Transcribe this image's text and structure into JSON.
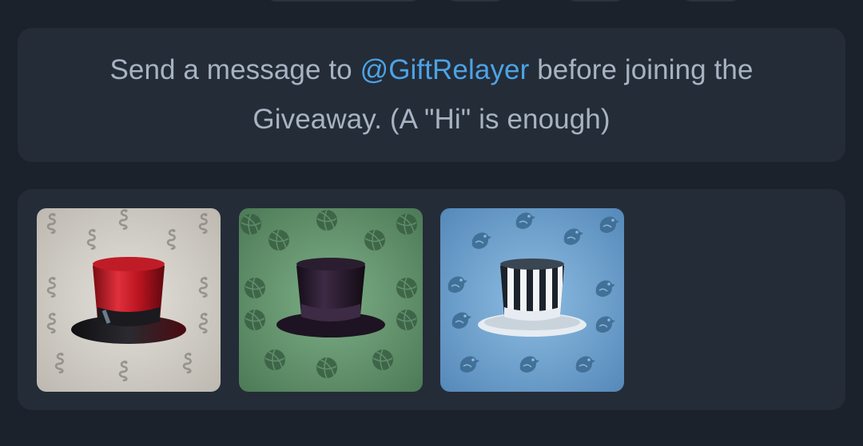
{
  "message": {
    "prefix": "Send a message to",
    "mention": "@GiftRelayer",
    "suffix": "before joining the Giveaway. (A \"Hi\" is enough)"
  },
  "gifts": [
    {
      "name": "Top Hat",
      "backdrop": "#cfcbc3",
      "pattern_color": "#8d8a84",
      "pattern": "snake-icon",
      "hat": "red-top-hat"
    },
    {
      "name": "Top Hat",
      "backdrop": "#5e8f6a",
      "pattern_color": "#3a5e44",
      "pattern": "ball-icon",
      "hat": "black-top-hat"
    },
    {
      "name": "Top Hat",
      "backdrop": "#6a9fcf",
      "pattern_color": "#3e6c93",
      "pattern": "bird-icon",
      "hat": "striped-top-hat"
    }
  ],
  "colors": {
    "page_bg": "#1b222b",
    "card_bg": "#242c37",
    "text": "#a7b3c2",
    "link": "#4ca3e6"
  }
}
